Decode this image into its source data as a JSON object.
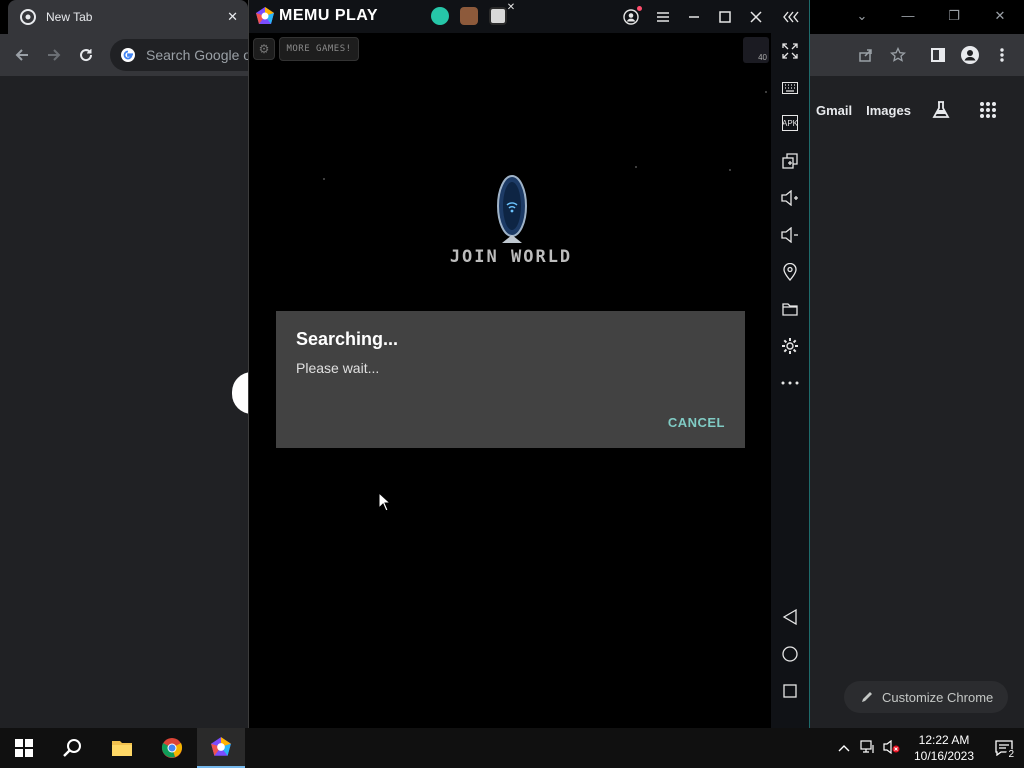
{
  "chrome": {
    "tab_title": "New Tab",
    "tab_close": "✕",
    "search_placeholder": "Search Google or",
    "links": [
      "Gmail",
      "Images"
    ],
    "customize_label": "Customize Chrome"
  },
  "memu": {
    "brand": "MEMU PLAY",
    "title_buttons": [
      "account-icon",
      "menu-icon",
      "minimize-icon",
      "maximize-icon",
      "close-icon",
      "collapse-icon"
    ],
    "sidebar_buttons": [
      "fullscreen-icon",
      "keyboard-icon",
      "apk-icon",
      "multi-window-icon",
      "volume-up-icon",
      "volume-down-icon",
      "location-icon",
      "folder-icon",
      "settings-icon",
      "more-icon",
      "back-icon",
      "home-icon",
      "recents-icon"
    ],
    "sidebar_apk_label": "APK"
  },
  "game": {
    "more_games": "MORE GAMES!",
    "corner_badge": "40",
    "join_world": "JOIN WORLD"
  },
  "dialog": {
    "title": "Searching...",
    "message": "Please wait...",
    "cancel": "CANCEL"
  },
  "taskbar": {
    "time": "12:22 AM",
    "date": "10/16/2023",
    "notification_count": "2"
  },
  "colors": {
    "dialog_bg": "#424242",
    "dialog_accent": "#80cbc4",
    "chrome_bg": "#202124",
    "memu_bar": "#101216"
  }
}
